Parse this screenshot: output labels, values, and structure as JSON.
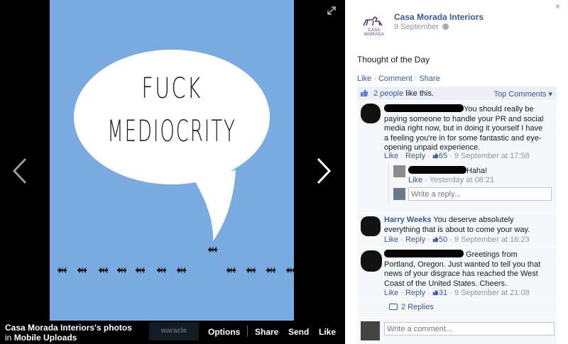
{
  "photo": {
    "line1": "FUCK",
    "line2": "MEDIOCRITY",
    "background_color": "#7aabe0"
  },
  "photo_bar": {
    "caption_title": "Casa Morada Interiors's photos",
    "caption_prefix": "in",
    "caption_album": "Mobile Uploads",
    "watermark": "waracle",
    "actions": {
      "options": "Options",
      "share": "Share",
      "send": "Send",
      "like": "Like"
    }
  },
  "post": {
    "close": "×",
    "logo_text": "CASA MORADA",
    "page_name": "Casa Morada Interiors",
    "date": "9 September",
    "text": "Thought of the Day",
    "actions": {
      "like": "Like",
      "comment": "Comment",
      "share": "Share",
      "sep": "·"
    },
    "likes_count": "2 people",
    "likes_suffix": " like this.",
    "top_comments": "Top Comments ▾"
  },
  "comments": [
    {
      "name": "",
      "text": "You should really be paying someone to handle your PR and social media right now, but in doing it yourself I have a feeling you're in for some fantastic and eye-opening unpaid experience.",
      "like": "Like",
      "reply": "Reply",
      "likes": "65",
      "time": "9 September at 17:58"
    },
    {
      "name": "Harry Weeks",
      "text": " You deserve absolutely everything that is about to come your way.",
      "like": "Like",
      "reply": "Reply",
      "likes": "50",
      "time": "9 September at 16:23"
    },
    {
      "name": "",
      "text": " Greetings from Portland, Oregon. Just wanted to tell you that news of your disgrace has reached the West Coast of the United States. Cheers.",
      "like": "Like",
      "reply": "Reply",
      "likes": "31",
      "time": "9 September at 21:08"
    }
  ],
  "reply": {
    "text": "Haha!",
    "like": "Like",
    "time": "Yesterday at 08:21",
    "input_placeholder": "Write a reply..."
  },
  "replies_link": "2 Replies",
  "composer": {
    "placeholder": "Write a comment..."
  },
  "colors": {
    "link": "#3b5998",
    "panel_gray": "#f6f7f9",
    "likes_bar": "#eceff5"
  }
}
